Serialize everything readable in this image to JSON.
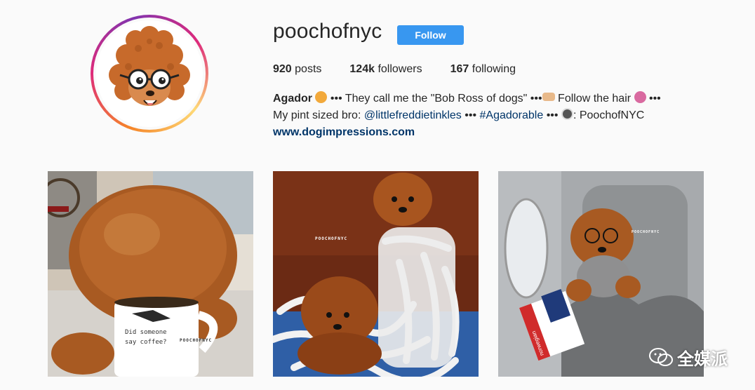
{
  "profile": {
    "username": "poochofnyc",
    "follow_label": "Follow",
    "stats": {
      "posts_count": "920",
      "posts_label": "posts",
      "followers_count": "124k",
      "followers_label": "followers",
      "following_count": "167",
      "following_label": "following"
    },
    "bio": {
      "name": "Agador",
      "line1_text": " ••• They call me the \"Bob Ross of dogs\" •••",
      "line1_text_b": " Follow the hair ",
      "line1_end": " •••",
      "line2_start": "My pint sized bro: ",
      "mention": "@littlefreddietinkles",
      "line2_mid": " ••• ",
      "hashtag": "#Agadorable",
      "line2_mid2": " ••• ",
      "line2_end": ": PoochofNYC",
      "website": "www.dogimpressions.com"
    }
  },
  "posts": [
    {
      "caption": "",
      "mug_text_1": "Did someone",
      "mug_text_2": "say coffee?",
      "watermark": "POOCHOFNYC"
    },
    {
      "watermark": "POOCHOFNYC"
    },
    {
      "watermark": "POOCHOFNYC",
      "ticket_text": "norwegian"
    }
  ],
  "watermark": {
    "text": "全媒派"
  },
  "colors": {
    "follow_button": "#3897f0",
    "link": "#003569",
    "background": "#fafafa"
  }
}
